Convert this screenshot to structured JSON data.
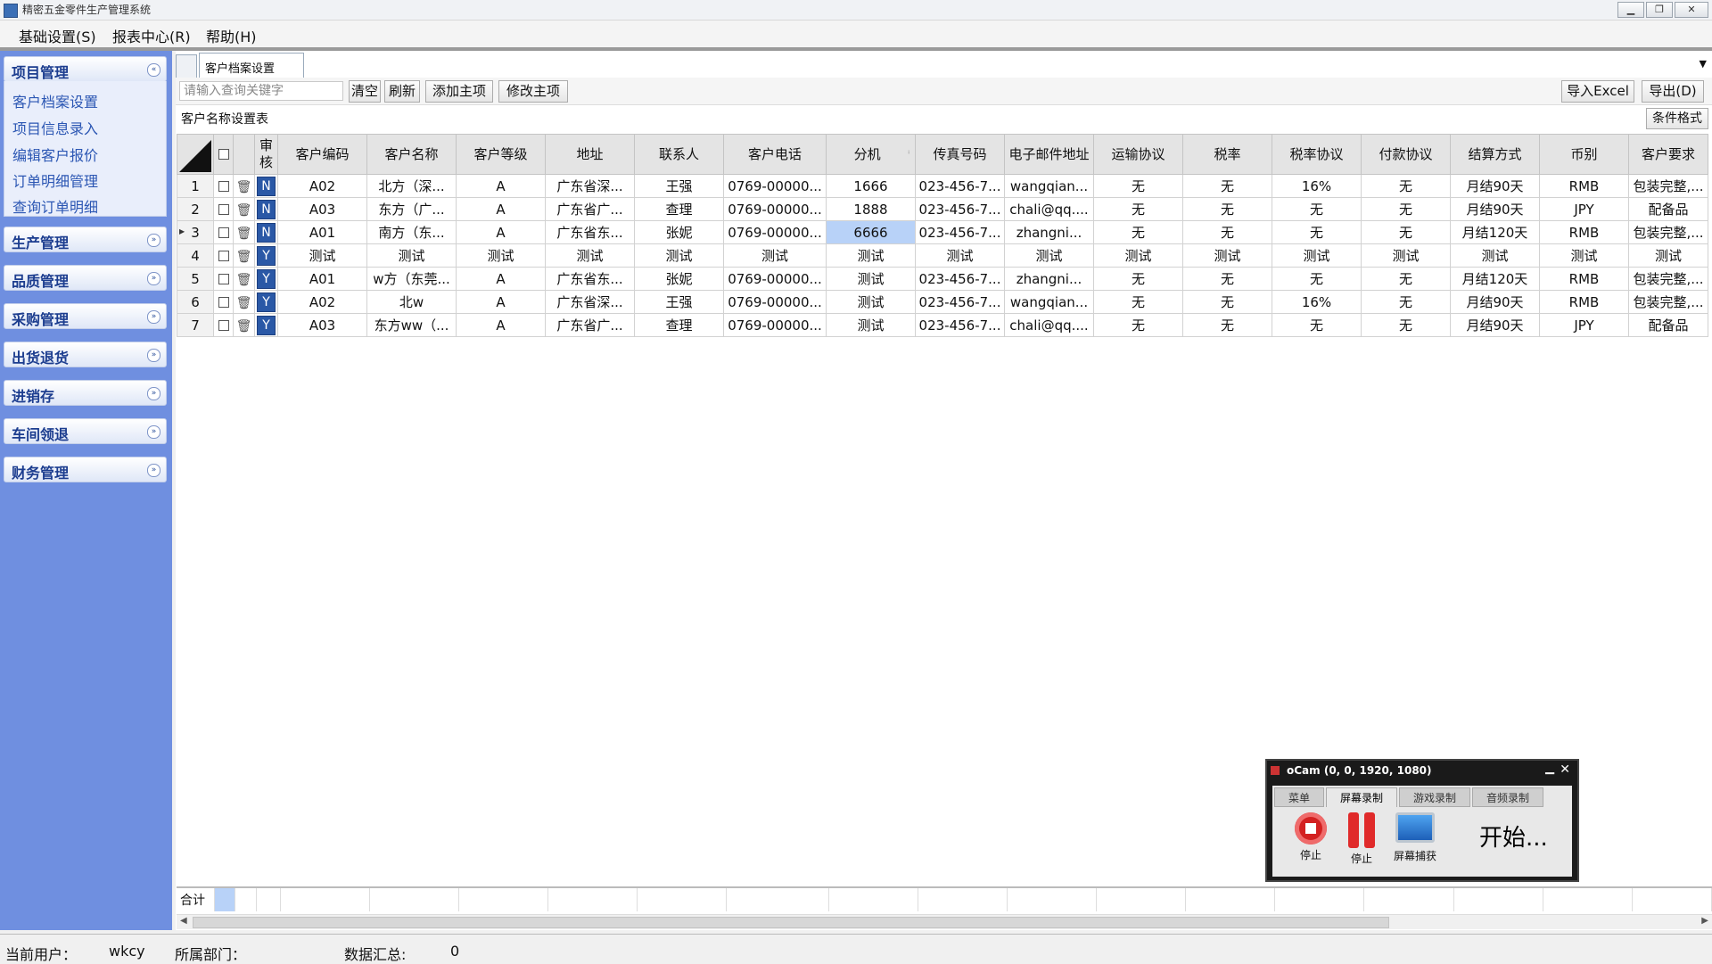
{
  "window": {
    "title": "精密五金零件生产管理系统",
    "buttons": [
      "▁",
      "❐",
      "✕"
    ]
  },
  "menu": [
    "基础设置(S)",
    "报表中心(R)",
    "帮助(H)"
  ],
  "sidebar": {
    "groups": [
      {
        "label": "项目管理",
        "expanded": true
      },
      {
        "label": "生产管理"
      },
      {
        "label": "品质管理"
      },
      {
        "label": "采购管理"
      },
      {
        "label": "出货退货"
      },
      {
        "label": "进销存"
      },
      {
        "label": "车间领退"
      },
      {
        "label": "财务管理"
      }
    ],
    "sub_items": [
      "客户档案设置",
      "项目信息录入",
      "编辑客户报价",
      "订单明细管理",
      "查询订单明细"
    ],
    "chev_up": "«",
    "chev_down": "»"
  },
  "tab": {
    "active_label": "客户档案设置",
    "dropdown": "▼"
  },
  "toolbar": {
    "search_placeholder": "请输入查询关键字",
    "clear": "清空",
    "refresh": "刷新",
    "add_main": "添加主项",
    "edit_main": "修改主项",
    "import_excel": "导入Excel",
    "export": "导出(D)"
  },
  "section_title": "客户名称设置表",
  "cond_format": "条件格式",
  "table": {
    "columns": [
      "审核",
      "客户编码",
      "客户名称",
      "客户等级",
      "地址",
      "联系人",
      "客户电话",
      "分机",
      "传真号码",
      "电子邮件地址",
      "运输协议",
      "税率",
      "税率协议",
      "付款协议",
      "结算方式",
      "币别",
      "客户要求"
    ],
    "rows": [
      {
        "num": "1",
        "audit": "N",
        "cells": [
          "A02",
          "北方（深...",
          "A",
          "广东省深...",
          "王强",
          "0769-00000...",
          "1666",
          "023-456-7...",
          "wangqian...",
          "无",
          "无",
          "16%",
          "无",
          "月结90天",
          "RMB",
          "包装完整,..."
        ]
      },
      {
        "num": "2",
        "audit": "N",
        "cells": [
          "A03",
          "东方（广...",
          "A",
          "广东省广...",
          "查理",
          "0769-00000...",
          "1888",
          "023-456-7...",
          "chali@qq....",
          "无",
          "无",
          "无",
          "无",
          "月结90天",
          "JPY",
          "配备品"
        ]
      },
      {
        "num": "3",
        "audit": "N",
        "cells": [
          "A01",
          "南方（东...",
          "A",
          "广东省东...",
          "张妮",
          "0769-00000...",
          "6666",
          "023-456-7...",
          "zhangni...",
          "无",
          "无",
          "无",
          "无",
          "月结120天",
          "RMB",
          "包装完整,..."
        ]
      },
      {
        "num": "4",
        "audit": "Y",
        "cells": [
          "测试",
          "测试",
          "测试",
          "测试",
          "测试",
          "测试",
          "测试",
          "测试",
          "测试",
          "测试",
          "测试",
          "测试",
          "测试",
          "测试",
          "测试",
          "测试"
        ]
      },
      {
        "num": "5",
        "audit": "Y",
        "cells": [
          "A01",
          "w方（东莞...",
          "A",
          "广东省东...",
          "张妮",
          "0769-00000...",
          "测试",
          "023-456-7...",
          "zhangni...",
          "无",
          "无",
          "无",
          "无",
          "月结120天",
          "RMB",
          "包装完整,..."
        ]
      },
      {
        "num": "6",
        "audit": "Y",
        "cells": [
          "A02",
          "北w",
          "A",
          "广东省深...",
          "王强",
          "0769-00000...",
          "测试",
          "023-456-7...",
          "wangqian...",
          "无",
          "无",
          "16%",
          "无",
          "月结90天",
          "RMB",
          "包装完整,..."
        ]
      },
      {
        "num": "7",
        "audit": "Y",
        "cells": [
          "A03",
          "东方ww（...",
          "A",
          "广东省广...",
          "查理",
          "0769-00000...",
          "测试",
          "023-456-7...",
          "chali@qq....",
          "无",
          "无",
          "无",
          "无",
          "月结90天",
          "JPY",
          "配备品"
        ]
      }
    ],
    "current_row_marker": "▶",
    "sort_marker": "ⁱ"
  },
  "totals_label": "合计",
  "status": {
    "user_label": "当前用户：",
    "user": "wkcy",
    "dept_label": "所属部门：",
    "summary_label": "数据汇总:",
    "summary_value": "0"
  },
  "ocam": {
    "title": "oCam (0, 0, 1920, 1080)",
    "tabs": [
      "菜单",
      "屏幕录制",
      "游戏录制",
      "音频录制"
    ],
    "stop_label": "停止",
    "pause_label": "停止",
    "capture_label": "屏幕捕获",
    "status": "开始..."
  }
}
